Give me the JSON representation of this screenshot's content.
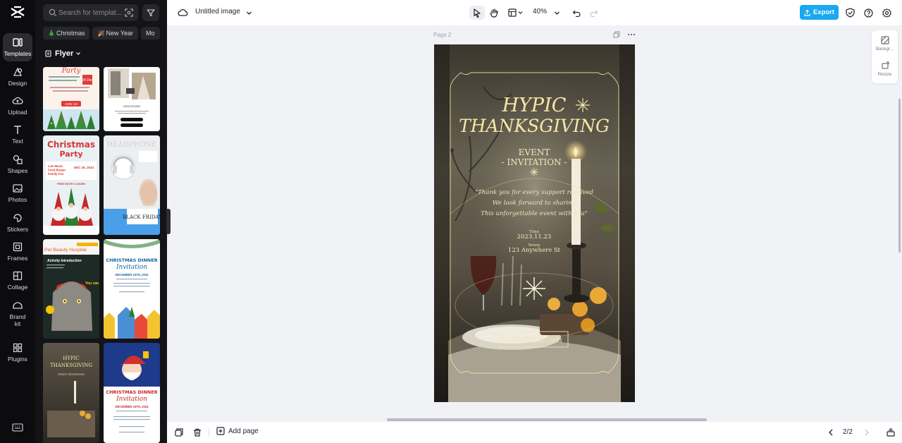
{
  "sidebar": {
    "items": [
      {
        "label": "Templates",
        "icon": "templates-icon"
      },
      {
        "label": "Design",
        "icon": "design-icon"
      },
      {
        "label": "Upload",
        "icon": "upload-icon"
      },
      {
        "label": "Text",
        "icon": "text-icon"
      },
      {
        "label": "Shapes",
        "icon": "shapes-icon"
      },
      {
        "label": "Photos",
        "icon": "photos-icon"
      },
      {
        "label": "Stickers",
        "icon": "stickers-icon"
      },
      {
        "label": "Frames",
        "icon": "frames-icon"
      },
      {
        "label": "Collage",
        "icon": "collage-icon"
      },
      {
        "label": "Brand\nkit",
        "icon": "brand-kit-icon"
      },
      {
        "label": "Plugins",
        "icon": "plugins-icon"
      }
    ]
  },
  "panel": {
    "search_placeholder": "Search for templat...",
    "chips": [
      {
        "emoji": "🎄",
        "label": "Christmas"
      },
      {
        "emoji": "🎉",
        "label": "New Year"
      },
      {
        "emoji": "",
        "label": "Mo"
      }
    ],
    "category": "Flyer",
    "thumbs": {
      "t1": {
        "title": "Party",
        "date": "24 Dec",
        "button": "JOIN US"
      },
      "t2": {
        "caption": "LOGO-STUDIO"
      },
      "t3": {
        "title": "Christmas",
        "title2": "Party",
        "list": "Live Music\nFood Bazaar\nFamily Fun",
        "date": "DEC 26, 2024",
        "free": "FREE ENTRY & MORE"
      },
      "t4": {
        "title": "HEADPHONE",
        "badge": "BLACK FRIDAY"
      },
      "t5": {
        "brand": "Pet Beauty Hospital",
        "sub": "Activity Introduction",
        "tag": "You can"
      },
      "t6": {
        "title": "CHRISTMAS DINNER",
        "script": "Invitation",
        "date": "DECEMBER 24TH, 2024"
      },
      "t7": {
        "title": "HYPIC",
        "title2": "THANKSGIVING",
        "sub": "EVENT INVITATION"
      },
      "t8": {
        "title": "CHRISTMAS DINNER",
        "script": "Invitation",
        "date": "DECEMBER 24TH, 2024"
      }
    }
  },
  "topbar": {
    "doc_title": "Untitled image",
    "zoom": "40%",
    "export_label": "Export"
  },
  "canvas": {
    "page_label": "Page 2",
    "side_tools": [
      {
        "label": "Backgr..."
      },
      {
        "label": "Resize"
      }
    ]
  },
  "artwork": {
    "title_line1": "HYPIC",
    "title_line2": "THANKSGIVING",
    "event": "EVENT",
    "invitation": "- INVITATION -",
    "quote_lines": [
      "\"Thank you for every support received",
      "We look forward to sharing",
      "This unforgettable event with you\""
    ],
    "time_label": "Time",
    "time_value": "2023.11.23",
    "venue_label": "Venue",
    "venue_value": "123 Anywhere St",
    "website": "www.hypic.com"
  },
  "bottombar": {
    "add_page": "Add page",
    "pager": "2/2"
  },
  "colors": {
    "rail_bg": "#0c0c0e",
    "panel_bg": "#141417",
    "accent": "#1aa8f0",
    "gold": "#f3e3a0"
  }
}
